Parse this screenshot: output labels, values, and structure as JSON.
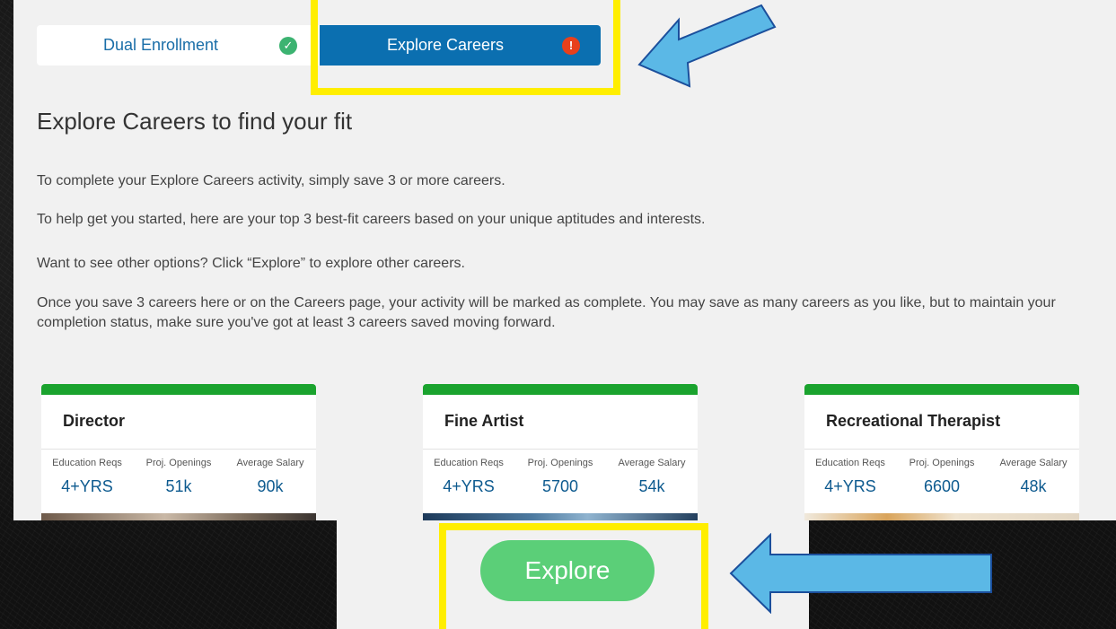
{
  "tabs": [
    {
      "label": "Dual Enrollment",
      "status": "complete",
      "status_icon": "check-circle-icon",
      "status_color": "#3cb371"
    },
    {
      "label": "Explore Careers",
      "status": "incomplete",
      "status_icon": "exclamation-circle-icon",
      "status_color": "#e8401c",
      "active": true
    }
  ],
  "heading": "Explore Careers to find your fit",
  "paragraphs": [
    "To complete your Explore Careers activity, simply save 3 or more careers.",
    "To help get you started, here are your top 3 best-fit careers based on your unique aptitudes and interests.",
    "Want to see other options? Click “Explore” to explore other careers.",
    "Once you save 3 careers here or on the Careers page, your activity will be marked as complete. You may save as many careers as you like, but to maintain your completion status, make sure you've got at least 3 careers saved moving forward."
  ],
  "stat_labels": [
    "Education Reqs",
    "Proj. Openings",
    "Average Salary"
  ],
  "careers": [
    {
      "title": "Director",
      "education": "4+YRS",
      "openings": "51k",
      "salary": "90k"
    },
    {
      "title": "Fine Artist",
      "education": "4+YRS",
      "openings": "5700",
      "salary": "54k"
    },
    {
      "title": "Recreational Therapist",
      "education": "4+YRS",
      "openings": "6600",
      "salary": "48k"
    }
  ],
  "explore_button": "Explore",
  "colors": {
    "active_tab": "#0b6fb0",
    "card_accent": "#1aa32e",
    "explore_button": "#5bcf78",
    "highlight": "#ffee00",
    "annotation_arrow": "#5bb8e6"
  }
}
